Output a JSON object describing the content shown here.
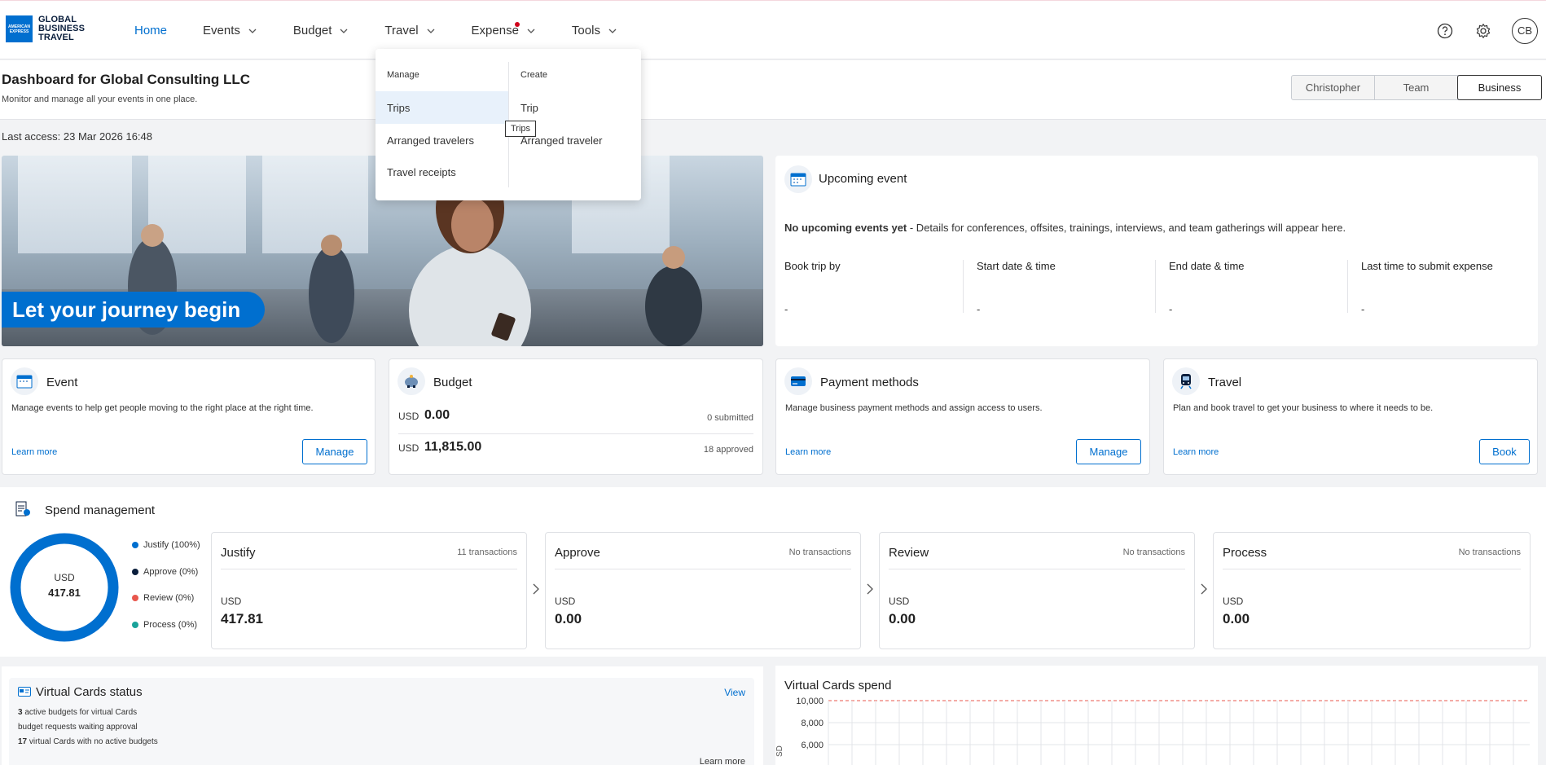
{
  "brand": {
    "logo_line1": "GLOBAL",
    "logo_line2": "BUSINESS",
    "logo_line3": "TRAVEL",
    "logo_mark": "AMERICAN EXPRESS"
  },
  "nav": {
    "home": "Home",
    "events": "Events",
    "budget": "Budget",
    "travel": "Travel",
    "expense": "Expense",
    "tools": "Tools"
  },
  "header": {
    "avatar_initials": "CB",
    "help_icon": "question-circle-icon",
    "settings_icon": "gear-icon"
  },
  "page": {
    "title": "Dashboard for Global Consulting LLC",
    "subtitle": "Monitor and manage all your events in one place.",
    "last_access": "Last access: 23 Mar 2026 16:48"
  },
  "scope_toggle": {
    "options": [
      "Christopher",
      "Team",
      "Business"
    ],
    "selected": "Business"
  },
  "hero": {
    "text": "Let your journey begin"
  },
  "upcoming": {
    "title": "Upcoming event",
    "empty_bold": "No upcoming events yet",
    "empty_rest": " - Details for conferences, offsites, trainings, interviews, and team gatherings will appear here.",
    "cols": [
      {
        "label": "Book trip by",
        "value": "-"
      },
      {
        "label": "Start date & time",
        "value": "-"
      },
      {
        "label": "End date & time",
        "value": "-"
      },
      {
        "label": "Last time to submit expense",
        "value": "-"
      }
    ]
  },
  "cards": {
    "event": {
      "title": "Event",
      "desc": "Manage events to help get people moving to the right place at the right time.",
      "link": "Learn more",
      "button": "Manage"
    },
    "budget": {
      "title": "Budget",
      "row1_cur": "USD",
      "row1_amt": "0.00",
      "row1_note": "0 submitted",
      "row2_cur": "USD",
      "row2_amt": "11,815.00",
      "row2_note": "18 approved"
    },
    "payment": {
      "title": "Payment methods",
      "desc": "Manage business payment methods and assign access to users.",
      "link": "Learn more",
      "button": "Manage"
    },
    "travel": {
      "title": "Travel",
      "desc": "Plan and book travel to get your business to where it needs to be.",
      "link": "Learn more",
      "button": "Book"
    }
  },
  "spend": {
    "title": "Spend management",
    "donut_cur": "USD",
    "donut_amt": "417.81",
    "legend": [
      {
        "label": "Justify (100%)",
        "color": "#006fcf"
      },
      {
        "label": "Approve (0%)",
        "color": "#0a1e3c"
      },
      {
        "label": "Review (0%)",
        "color": "#e8574d"
      },
      {
        "label": "Process (0%)",
        "color": "#1aa39a"
      }
    ],
    "stages": [
      {
        "title": "Justify",
        "count": "11 transactions",
        "cur": "USD",
        "amt": "417.81"
      },
      {
        "title": "Approve",
        "count": "No transactions",
        "cur": "USD",
        "amt": "0.00"
      },
      {
        "title": "Review",
        "count": "No transactions",
        "cur": "USD",
        "amt": "0.00"
      },
      {
        "title": "Process",
        "count": "No transactions",
        "cur": "USD",
        "amt": "0.00"
      }
    ]
  },
  "vc_status": {
    "title": "Virtual Cards status",
    "view": "View",
    "line1_num": "3",
    "line1_text": " active budgets for virtual Cards",
    "line2_text": "budget requests waiting approval",
    "line3_num": "17",
    "line3_text": " virtual Cards with no active budgets",
    "learn_more": "Learn more"
  },
  "vc_spend": {
    "title": "Virtual Cards spend",
    "y_ticks": [
      "10,000",
      "8,000",
      "6,000"
    ],
    "y_label_fragment": "SD"
  },
  "travel_menu": {
    "manage_head": "Manage",
    "create_head": "Create",
    "manage_items": [
      "Trips",
      "Arranged travelers",
      "Travel receipts"
    ],
    "create_items": [
      "Trip",
      "Arranged traveler"
    ],
    "tooltip": "Trips"
  },
  "chart_data": {
    "type": "bar",
    "title": "Virtual Cards spend",
    "y_ticks": [
      10000,
      8000,
      6000
    ],
    "reference_line": 10000
  }
}
